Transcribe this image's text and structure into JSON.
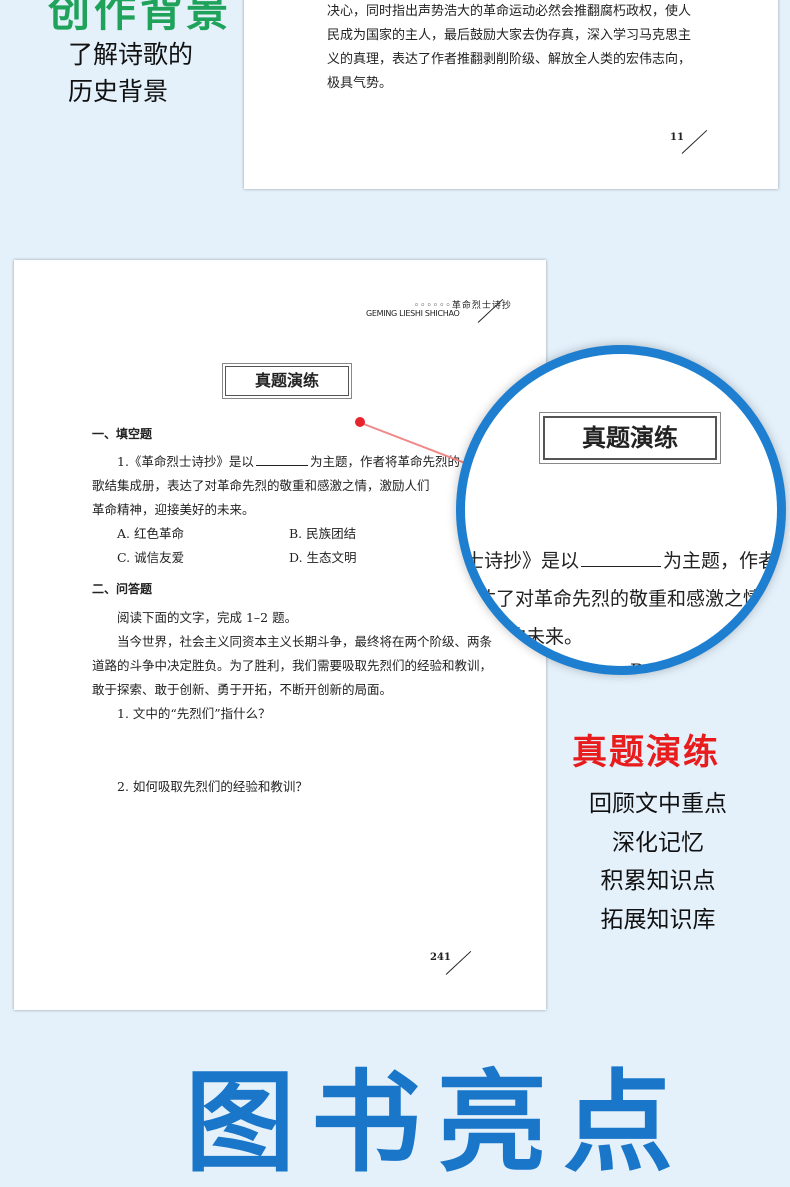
{
  "top_section": {
    "heading": "创作背景",
    "subtitle_lines": [
      "了解诗歌的",
      "历史背景"
    ]
  },
  "top_page": {
    "paragraph_lines": [
      "决心，同时指出声势浩大的革命运动必然会推翻腐朽政权，使人",
      "民成为国家的主人，最后鼓励大家去伪存真，深入学习马克思主",
      "义的真理，表达了作者推翻剥削阶级、解放全人类的宏伟志向，",
      "极具气势。"
    ],
    "page_number": "11"
  },
  "main_page": {
    "header_cn": "◦◦◦◦◦◦革命烈士诗抄",
    "header_en": "GEMING LIESHI SHICHAO",
    "title": "真题演练",
    "section1_heading": "一、填空题",
    "q1_prefix": "1.《革命烈士诗抄》是以",
    "q1_suffix": "为主题，作者将革命先烈的",
    "q1_line2": "歌结集成册，表达了对革命先烈的敬重和感激之情，激励人们",
    "q1_line3": "革命精神，迎接美好的未来。",
    "options": {
      "a": "A. 红色革命",
      "b": "B. 民族团结",
      "c": "C. 诚信友爱",
      "d": "D. 生态文明"
    },
    "section2_heading": "二、问答题",
    "reading_intro": "阅读下面的文字，完成 1–2 题。",
    "passage_lines": [
      "当今世界，社会主义同资本主义长期斗争，最终将在两个阶级、两条",
      "道路的斗争中决定胜负。为了胜利，我们需要吸取先烈们的经验和教训，",
      "敢于探索、敢于创新、勇于开拓，不断开创新的局面。"
    ],
    "q2_1": "1. 文中的“先烈们”指什么？",
    "q2_2": "2. 如何吸取先烈们的经验和教训？",
    "page_number": "241"
  },
  "magnifier": {
    "title": "真题演练",
    "line1_prefix": "士诗抄》是以",
    "line1_suffix": "为主题，作者",
    "line2": "达了对革命先烈的敬重和感激之情",
    "line3": "的未来。",
    "line4": "B. 民族团"
  },
  "right_section": {
    "heading": "真题演练",
    "items": [
      "回顾文中重点",
      "深化记忆",
      "积累知识点",
      "拓展知识库"
    ]
  },
  "bottom_heading": "图书亮点"
}
